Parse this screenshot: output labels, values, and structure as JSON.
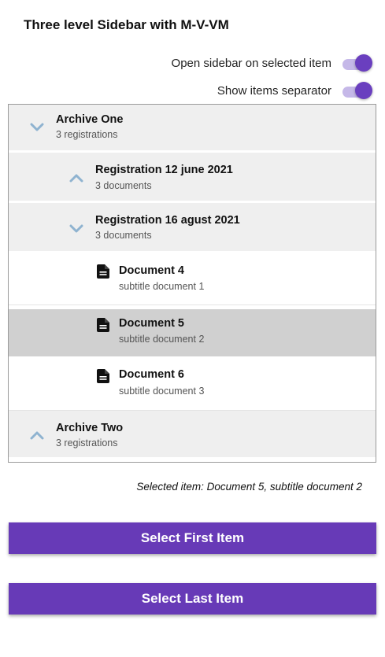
{
  "title": "Three level Sidebar with M-V-VM",
  "toggles": {
    "open_sidebar_label": "Open sidebar on selected item",
    "show_separator_label": "Show items separator"
  },
  "sidebar": {
    "archive_one": {
      "title": "Archive One",
      "subtitle": "3 registrations",
      "expanded": true
    },
    "registration_12": {
      "title": "Registration 12 june 2021",
      "subtitle": "3 documents",
      "expanded": false
    },
    "registration_16": {
      "title": "Registration 16 agust 2021",
      "subtitle": "3 documents",
      "expanded": true
    },
    "documents": [
      {
        "title": "Document 4",
        "subtitle": "subtitle document 1"
      },
      {
        "title": "Document 5",
        "subtitle": "subtitle document 2",
        "selected": true
      },
      {
        "title": "Document 6",
        "subtitle": "subtitle document 3"
      }
    ],
    "archive_two": {
      "title": "Archive Two",
      "subtitle": "3 registrations",
      "expanded": false
    }
  },
  "selected_item": "Selected item: Document 5, subtitle document 2",
  "buttons": {
    "select_first": "Select First Item",
    "select_last": "Select Last Item"
  },
  "colors": {
    "accent": "#673ab7",
    "toggle_thumb": "#6a3fbf",
    "toggle_track": "#c5b8e8",
    "chevron": "#8fb3d0",
    "row_grey": "#efefef",
    "row_selected": "#d0d0d0"
  }
}
